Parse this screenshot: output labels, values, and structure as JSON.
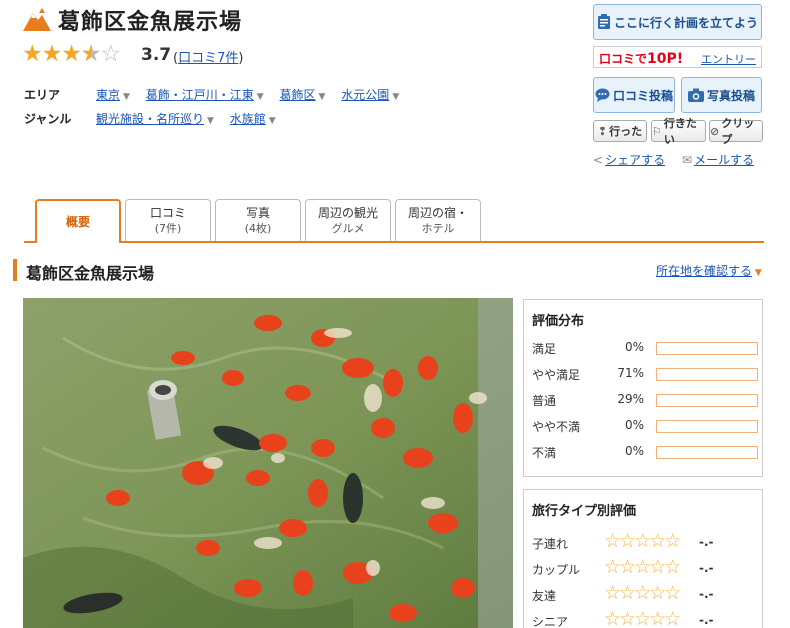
{
  "spot": {
    "title": "葛飾区金魚展示場",
    "rating": "3.7",
    "stars_value": 3.5,
    "review_count_label": "口コミ7件"
  },
  "meta": {
    "area_label": "エリア",
    "area_items": [
      "東京",
      "葛飾・江戸川・江東",
      "葛飾区",
      "水元公園"
    ],
    "genre_label": "ジャンル",
    "genre_items": [
      "観光施設・名所巡り",
      "水族館"
    ]
  },
  "actions": {
    "plan_label": "ここに行く計画を立てよう",
    "points_prefix": "口コミで",
    "points_value": "10P!",
    "entry_label": "エントリー",
    "post_review_label": "口コミ投稿",
    "post_photo_label": "写真投稿",
    "went_label": "行った",
    "want_label": "行きたい",
    "clip_label": "クリップ",
    "share_label": "シェアする",
    "mail_label": "メールする"
  },
  "tabs": [
    {
      "label": "概要",
      "sub": ""
    },
    {
      "label": "口コミ",
      "sub": "(7件)"
    },
    {
      "label": "写真",
      "sub": "(4枚)"
    },
    {
      "label": "周辺の観光",
      "sub": "グルメ"
    },
    {
      "label": "周辺の宿・",
      "sub": "ホテル"
    }
  ],
  "section": {
    "title": "葛飾区金魚展示場",
    "location_link": "所在地を確認する"
  },
  "rating_distribution": {
    "title": "評価分布",
    "rows": [
      {
        "label": "満足",
        "percent": "0%",
        "value": 0
      },
      {
        "label": "やや満足",
        "percent": "71%",
        "value": 71
      },
      {
        "label": "普通",
        "percent": "29%",
        "value": 29
      },
      {
        "label": "やや不満",
        "percent": "0%",
        "value": 0
      },
      {
        "label": "不満",
        "percent": "0%",
        "value": 0
      }
    ]
  },
  "travel_type": {
    "title": "旅行タイプ別評価",
    "rows": [
      {
        "label": "子連れ",
        "value": "-.-"
      },
      {
        "label": "カップル",
        "value": "-.-"
      },
      {
        "label": "友達",
        "value": "-.-"
      },
      {
        "label": "シニア",
        "value": "-.-"
      }
    ]
  },
  "colors": {
    "accent": "#e87d1e",
    "link": "#1a55b5",
    "star": "#f5a623",
    "button_bg": "#e8f2fb",
    "button_text": "#1a4f8e",
    "points_red": "#e2001a"
  },
  "icons": [
    "mountain-logo-icon",
    "notepad-icon",
    "speech-bubble-icon",
    "camera-icon",
    "footprint-icon",
    "walking-icon",
    "paperclip-icon",
    "share-icon",
    "mail-icon"
  ]
}
